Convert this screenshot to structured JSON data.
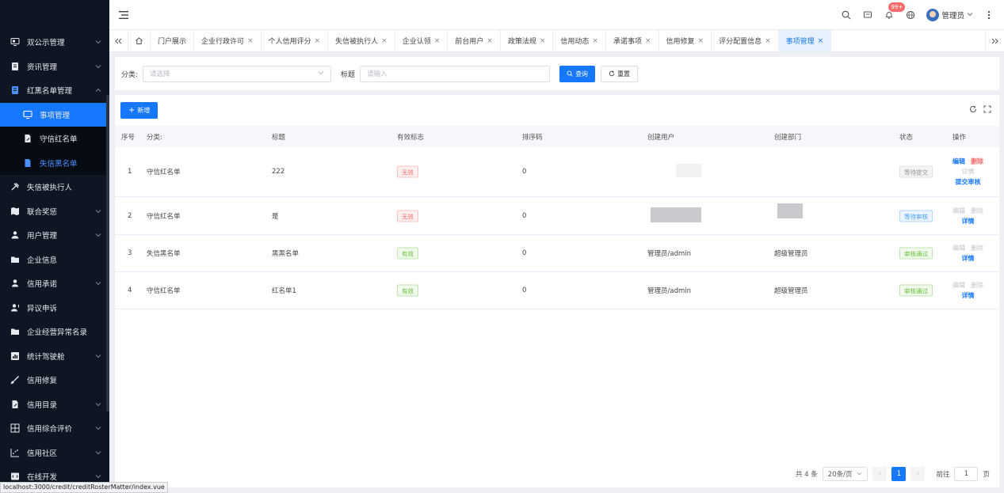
{
  "sidebar": {
    "items": [
      {
        "label": "双公示管理",
        "icon": "monitor-icon",
        "chevron": true
      },
      {
        "label": "资讯管理",
        "icon": "news-icon",
        "chevron": true
      },
      {
        "label": "红黑名单管理",
        "icon": "roster-icon",
        "chevron": true,
        "open": true
      },
      {
        "label": "事项管理",
        "icon": "desktop-icon",
        "sub": true,
        "active": true
      },
      {
        "label": "守信红名单",
        "icon": "file-edit-icon",
        "sub": true
      },
      {
        "label": "失信黑名单",
        "icon": "file-icon",
        "sub": true,
        "current": true
      },
      {
        "label": "失信被执行人",
        "icon": "tool-icon"
      },
      {
        "label": "联合奖惩",
        "icon": "map-icon",
        "chevron": true
      },
      {
        "label": "用户管理",
        "icon": "users-icon",
        "chevron": true
      },
      {
        "label": "企业信息",
        "icon": "folder-icon"
      },
      {
        "label": "信用承诺",
        "icon": "person-icon",
        "chevron": true
      },
      {
        "label": "异议申诉",
        "icon": "person-alert-icon"
      },
      {
        "label": "企业经营异常名录",
        "icon": "folder-icon"
      },
      {
        "label": "统计驾驶舱",
        "icon": "chart-icon",
        "chevron": true
      },
      {
        "label": "信用修复",
        "icon": "brush-icon"
      },
      {
        "label": "信用目录",
        "icon": "file-edit-icon",
        "chevron": true
      },
      {
        "label": "信用综合评价",
        "icon": "grid-icon",
        "chevron": true
      },
      {
        "label": "信用社区",
        "icon": "scatter-icon",
        "chevron": true
      },
      {
        "label": "在线开发",
        "icon": "code-icon",
        "chevron": true
      }
    ]
  },
  "header": {
    "notification_count": "99+",
    "user_name": "管理员"
  },
  "tabs": [
    {
      "label": "门户展示",
      "closable": false
    },
    {
      "label": "企业行政许可",
      "closable": true
    },
    {
      "label": "个人信用评分",
      "closable": true
    },
    {
      "label": "失信被执行人",
      "closable": true
    },
    {
      "label": "企业认领",
      "closable": true
    },
    {
      "label": "前台用户",
      "closable": true
    },
    {
      "label": "政策法规",
      "closable": true
    },
    {
      "label": "信用动态",
      "closable": true
    },
    {
      "label": "承诺事项",
      "closable": true
    },
    {
      "label": "信用修复",
      "closable": true
    },
    {
      "label": "评分配置信息",
      "closable": true
    },
    {
      "label": "事项管理",
      "closable": true,
      "active": true
    }
  ],
  "filter": {
    "category_label": "分类:",
    "category_placeholder": "请选择",
    "title_label": "标题",
    "title_placeholder": "请输入",
    "search_label": "查询",
    "reset_label": "重置"
  },
  "toolbar": {
    "add_label": "新增"
  },
  "table": {
    "columns": [
      "序号",
      "分类:",
      "标题",
      "有效标志",
      "排序码",
      "创建用户",
      "创建部门",
      "状态",
      "操作"
    ],
    "rows": [
      {
        "index": "1",
        "category": "守信红名单",
        "title": "222",
        "valid": "无效",
        "valid_type": "red",
        "sort": "0",
        "user": "",
        "dept": "",
        "status": "等待提交",
        "status_type": "gray",
        "ops": [
          "编辑",
          "删除",
          "详情",
          "提交审核"
        ],
        "ops_style": [
          "blue",
          "red",
          "gray",
          "blue"
        ],
        "blur_user": "small"
      },
      {
        "index": "2",
        "category": "守信红名单",
        "title": "是",
        "valid": "无效",
        "valid_type": "red",
        "sort": "0",
        "user": "",
        "dept": "",
        "status": "等待审核",
        "status_type": "blue",
        "ops": [
          "编辑",
          "删除",
          "详情"
        ],
        "ops_style": [
          "gray",
          "gray",
          "blue"
        ],
        "blur_user": "big",
        "blur_dept": true
      },
      {
        "index": "3",
        "category": "失信黑名单",
        "title": "黑黑名单",
        "valid": "有效",
        "valid_type": "green",
        "sort": "0",
        "user": "管理员/admin",
        "dept": "超级管理员",
        "status": "审核通过",
        "status_type": "green",
        "ops": [
          "编辑",
          "删除",
          "详情"
        ],
        "ops_style": [
          "gray",
          "gray",
          "blue"
        ]
      },
      {
        "index": "4",
        "category": "守信红名单",
        "title": "红名单1",
        "valid": "有效",
        "valid_type": "green",
        "sort": "0",
        "user": "管理员/admin",
        "dept": "超级管理员",
        "status": "审核通过",
        "status_type": "green",
        "ops": [
          "编辑",
          "删除",
          "详情"
        ],
        "ops_style": [
          "gray",
          "gray",
          "blue"
        ]
      }
    ]
  },
  "pager": {
    "total": "共 4 条",
    "page_size": "20条/页",
    "current_page": "1",
    "goto_prefix": "前往",
    "goto_value": "1",
    "goto_suffix": "页"
  },
  "status_url": "localhost:3000/credit/creditRosterMatter/index.vue"
}
